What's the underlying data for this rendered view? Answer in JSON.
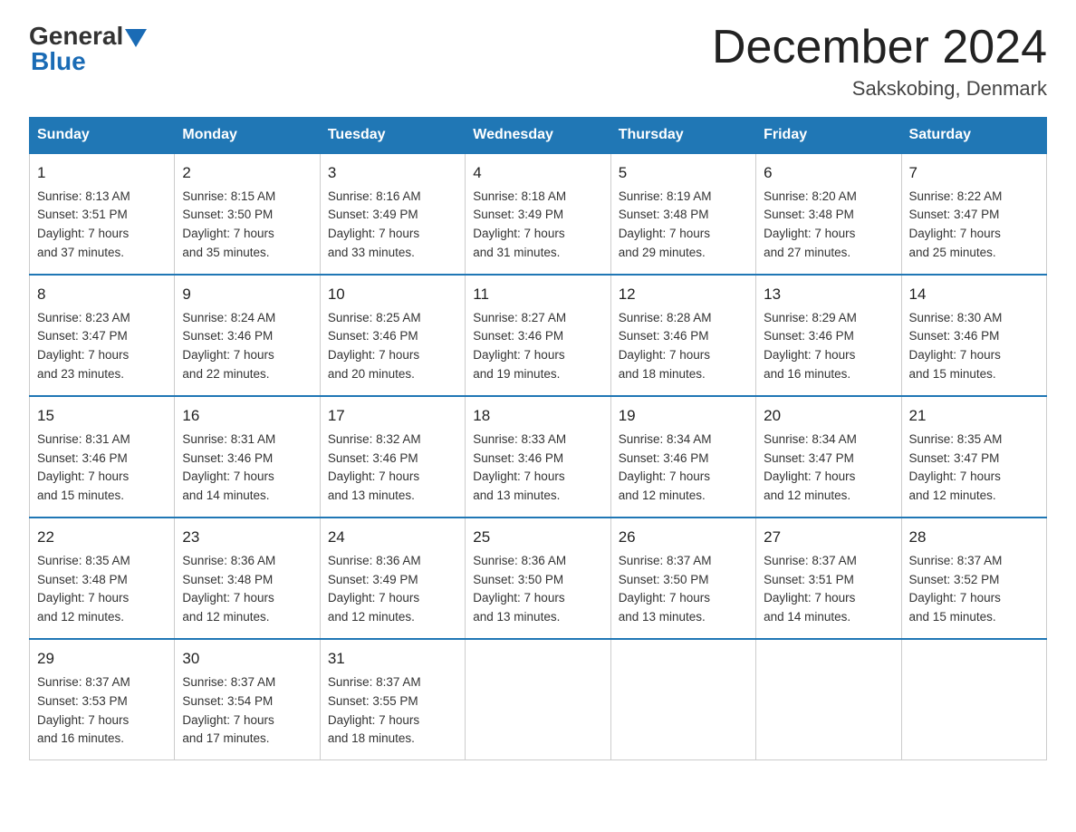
{
  "header": {
    "logo": {
      "general": "General",
      "blue": "Blue"
    },
    "title": "December 2024",
    "location": "Sakskobing, Denmark"
  },
  "days_of_week": [
    "Sunday",
    "Monday",
    "Tuesday",
    "Wednesday",
    "Thursday",
    "Friday",
    "Saturday"
  ],
  "weeks": [
    [
      {
        "day": "1",
        "sunrise": "Sunrise: 8:13 AM",
        "sunset": "Sunset: 3:51 PM",
        "daylight": "Daylight: 7 hours",
        "daylight2": "and 37 minutes."
      },
      {
        "day": "2",
        "sunrise": "Sunrise: 8:15 AM",
        "sunset": "Sunset: 3:50 PM",
        "daylight": "Daylight: 7 hours",
        "daylight2": "and 35 minutes."
      },
      {
        "day": "3",
        "sunrise": "Sunrise: 8:16 AM",
        "sunset": "Sunset: 3:49 PM",
        "daylight": "Daylight: 7 hours",
        "daylight2": "and 33 minutes."
      },
      {
        "day": "4",
        "sunrise": "Sunrise: 8:18 AM",
        "sunset": "Sunset: 3:49 PM",
        "daylight": "Daylight: 7 hours",
        "daylight2": "and 31 minutes."
      },
      {
        "day": "5",
        "sunrise": "Sunrise: 8:19 AM",
        "sunset": "Sunset: 3:48 PM",
        "daylight": "Daylight: 7 hours",
        "daylight2": "and 29 minutes."
      },
      {
        "day": "6",
        "sunrise": "Sunrise: 8:20 AM",
        "sunset": "Sunset: 3:48 PM",
        "daylight": "Daylight: 7 hours",
        "daylight2": "and 27 minutes."
      },
      {
        "day": "7",
        "sunrise": "Sunrise: 8:22 AM",
        "sunset": "Sunset: 3:47 PM",
        "daylight": "Daylight: 7 hours",
        "daylight2": "and 25 minutes."
      }
    ],
    [
      {
        "day": "8",
        "sunrise": "Sunrise: 8:23 AM",
        "sunset": "Sunset: 3:47 PM",
        "daylight": "Daylight: 7 hours",
        "daylight2": "and 23 minutes."
      },
      {
        "day": "9",
        "sunrise": "Sunrise: 8:24 AM",
        "sunset": "Sunset: 3:46 PM",
        "daylight": "Daylight: 7 hours",
        "daylight2": "and 22 minutes."
      },
      {
        "day": "10",
        "sunrise": "Sunrise: 8:25 AM",
        "sunset": "Sunset: 3:46 PM",
        "daylight": "Daylight: 7 hours",
        "daylight2": "and 20 minutes."
      },
      {
        "day": "11",
        "sunrise": "Sunrise: 8:27 AM",
        "sunset": "Sunset: 3:46 PM",
        "daylight": "Daylight: 7 hours",
        "daylight2": "and 19 minutes."
      },
      {
        "day": "12",
        "sunrise": "Sunrise: 8:28 AM",
        "sunset": "Sunset: 3:46 PM",
        "daylight": "Daylight: 7 hours",
        "daylight2": "and 18 minutes."
      },
      {
        "day": "13",
        "sunrise": "Sunrise: 8:29 AM",
        "sunset": "Sunset: 3:46 PM",
        "daylight": "Daylight: 7 hours",
        "daylight2": "and 16 minutes."
      },
      {
        "day": "14",
        "sunrise": "Sunrise: 8:30 AM",
        "sunset": "Sunset: 3:46 PM",
        "daylight": "Daylight: 7 hours",
        "daylight2": "and 15 minutes."
      }
    ],
    [
      {
        "day": "15",
        "sunrise": "Sunrise: 8:31 AM",
        "sunset": "Sunset: 3:46 PM",
        "daylight": "Daylight: 7 hours",
        "daylight2": "and 15 minutes."
      },
      {
        "day": "16",
        "sunrise": "Sunrise: 8:31 AM",
        "sunset": "Sunset: 3:46 PM",
        "daylight": "Daylight: 7 hours",
        "daylight2": "and 14 minutes."
      },
      {
        "day": "17",
        "sunrise": "Sunrise: 8:32 AM",
        "sunset": "Sunset: 3:46 PM",
        "daylight": "Daylight: 7 hours",
        "daylight2": "and 13 minutes."
      },
      {
        "day": "18",
        "sunrise": "Sunrise: 8:33 AM",
        "sunset": "Sunset: 3:46 PM",
        "daylight": "Daylight: 7 hours",
        "daylight2": "and 13 minutes."
      },
      {
        "day": "19",
        "sunrise": "Sunrise: 8:34 AM",
        "sunset": "Sunset: 3:46 PM",
        "daylight": "Daylight: 7 hours",
        "daylight2": "and 12 minutes."
      },
      {
        "day": "20",
        "sunrise": "Sunrise: 8:34 AM",
        "sunset": "Sunset: 3:47 PM",
        "daylight": "Daylight: 7 hours",
        "daylight2": "and 12 minutes."
      },
      {
        "day": "21",
        "sunrise": "Sunrise: 8:35 AM",
        "sunset": "Sunset: 3:47 PM",
        "daylight": "Daylight: 7 hours",
        "daylight2": "and 12 minutes."
      }
    ],
    [
      {
        "day": "22",
        "sunrise": "Sunrise: 8:35 AM",
        "sunset": "Sunset: 3:48 PM",
        "daylight": "Daylight: 7 hours",
        "daylight2": "and 12 minutes."
      },
      {
        "day": "23",
        "sunrise": "Sunrise: 8:36 AM",
        "sunset": "Sunset: 3:48 PM",
        "daylight": "Daylight: 7 hours",
        "daylight2": "and 12 minutes."
      },
      {
        "day": "24",
        "sunrise": "Sunrise: 8:36 AM",
        "sunset": "Sunset: 3:49 PM",
        "daylight": "Daylight: 7 hours",
        "daylight2": "and 12 minutes."
      },
      {
        "day": "25",
        "sunrise": "Sunrise: 8:36 AM",
        "sunset": "Sunset: 3:50 PM",
        "daylight": "Daylight: 7 hours",
        "daylight2": "and 13 minutes."
      },
      {
        "day": "26",
        "sunrise": "Sunrise: 8:37 AM",
        "sunset": "Sunset: 3:50 PM",
        "daylight": "Daylight: 7 hours",
        "daylight2": "and 13 minutes."
      },
      {
        "day": "27",
        "sunrise": "Sunrise: 8:37 AM",
        "sunset": "Sunset: 3:51 PM",
        "daylight": "Daylight: 7 hours",
        "daylight2": "and 14 minutes."
      },
      {
        "day": "28",
        "sunrise": "Sunrise: 8:37 AM",
        "sunset": "Sunset: 3:52 PM",
        "daylight": "Daylight: 7 hours",
        "daylight2": "and 15 minutes."
      }
    ],
    [
      {
        "day": "29",
        "sunrise": "Sunrise: 8:37 AM",
        "sunset": "Sunset: 3:53 PM",
        "daylight": "Daylight: 7 hours",
        "daylight2": "and 16 minutes."
      },
      {
        "day": "30",
        "sunrise": "Sunrise: 8:37 AM",
        "sunset": "Sunset: 3:54 PM",
        "daylight": "Daylight: 7 hours",
        "daylight2": "and 17 minutes."
      },
      {
        "day": "31",
        "sunrise": "Sunrise: 8:37 AM",
        "sunset": "Sunset: 3:55 PM",
        "daylight": "Daylight: 7 hours",
        "daylight2": "and 18 minutes."
      },
      null,
      null,
      null,
      null
    ]
  ]
}
